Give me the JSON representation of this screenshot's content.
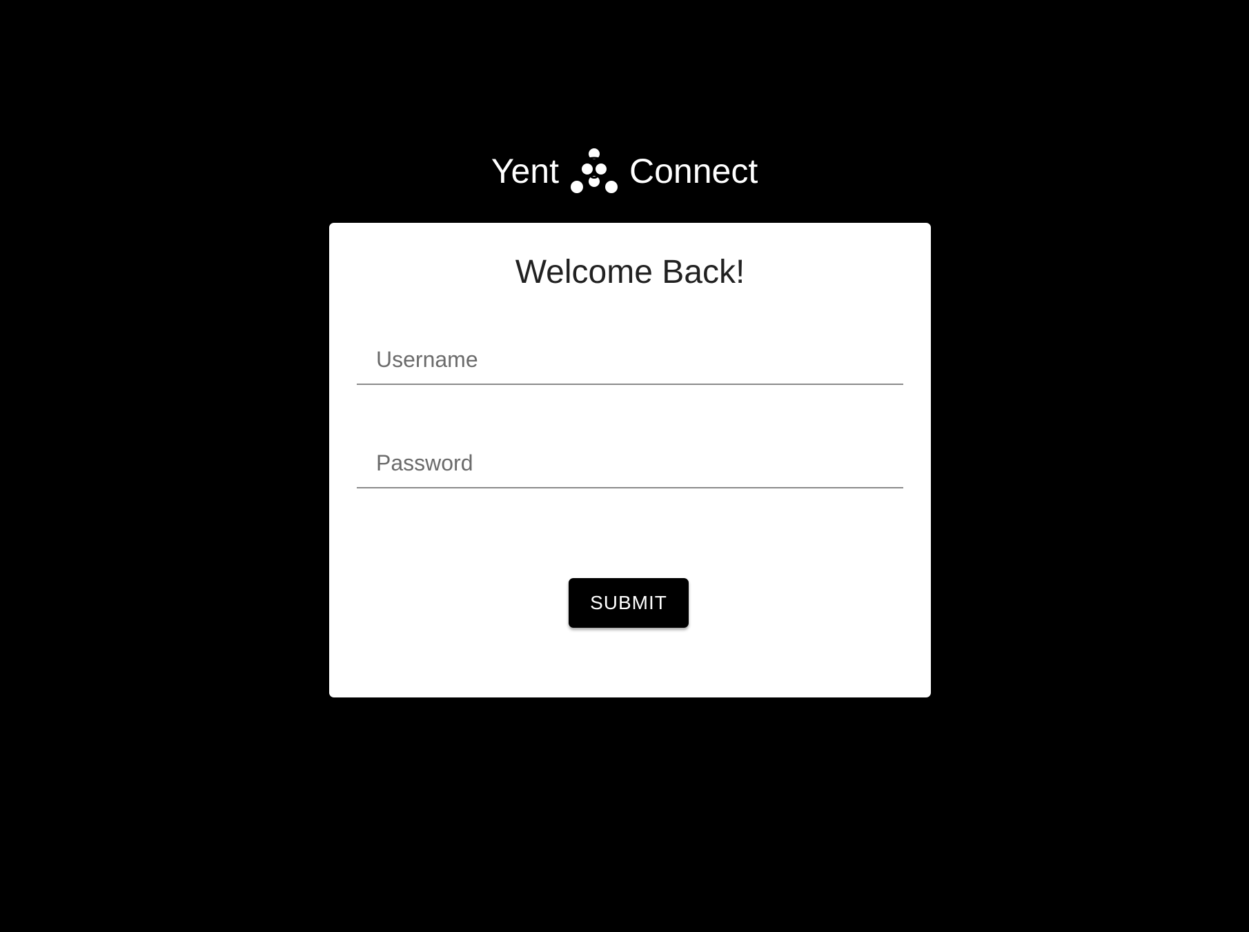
{
  "brand": {
    "left_word": "Yent",
    "right_word": "Connect",
    "logo_icon": "triple-knot-logo-icon"
  },
  "login": {
    "title": "Welcome Back!",
    "username_placeholder": "Username",
    "username_value": "",
    "password_placeholder": "Password",
    "password_value": "",
    "submit_label": "SUBMIT"
  },
  "colors": {
    "background": "#000000",
    "card": "#ffffff",
    "button": "#000000",
    "button_text": "#ffffff",
    "title_text": "#212121",
    "placeholder_text": "#6b6b6b",
    "field_underline": "#8a8a8a"
  }
}
